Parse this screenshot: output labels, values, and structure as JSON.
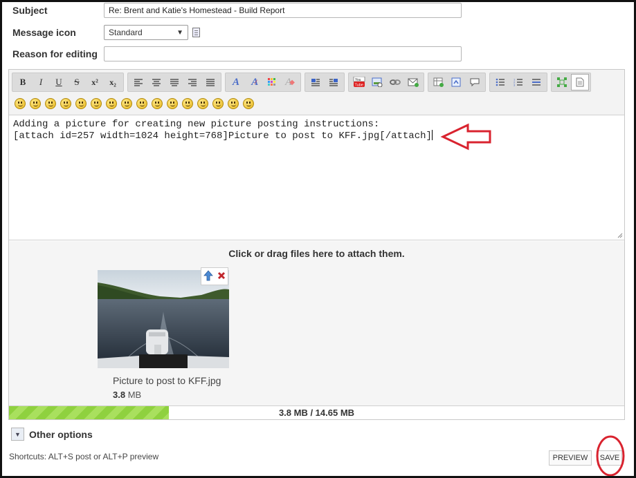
{
  "form": {
    "subject_label": "Subject",
    "subject_value": "Re: Brent and Katie's Homestead - Build Report",
    "icon_label": "Message icon",
    "icon_value": "Standard",
    "reason_label": "Reason for editing",
    "reason_value": ""
  },
  "toolbar": {
    "bold": "B",
    "italic": "I",
    "underline": "U",
    "strike": "S",
    "superscript": "x²",
    "subscript": "x₂",
    "icons": [
      "align-left-icon",
      "align-center-icon",
      "align-justify-icon",
      "align-right-icon",
      "align-full-icon",
      "font-color-icon",
      "font-size-icon",
      "color-palette-icon",
      "clear-format-icon",
      "indent-left-icon",
      "indent-right-icon",
      "youtube-icon",
      "image-icon",
      "link-icon",
      "email-icon",
      "table-icon",
      "code-icon",
      "quote-icon",
      "bullet-list-icon",
      "numbered-list-icon",
      "horizontal-rule-icon",
      "maximize-icon",
      "source-mode-icon"
    ],
    "smiley_count": 16
  },
  "editor": {
    "line1": "Adding a picture for creating new picture posting instructions:",
    "line2": "[attach id=257 width=1024 height=768]Picture to post to KFF.jpg[/attach]"
  },
  "attachments": {
    "drop_hint": "Click or drag files here to attach them.",
    "file_name": "Picture to post to KFF.jpg",
    "file_size_value": "3.8",
    "file_size_unit": "MB",
    "usage_text": "3.8 MB / 14.65 MB",
    "usage_fraction": 0.26
  },
  "other_options_label": "Other options",
  "shortcuts_text": "Shortcuts: ALT+S post or ALT+P preview",
  "buttons": {
    "preview": "PREVIEW",
    "save": "SAVE"
  },
  "colors": {
    "annotation_red": "#d9232f",
    "progress_green": "#8fd13f"
  }
}
